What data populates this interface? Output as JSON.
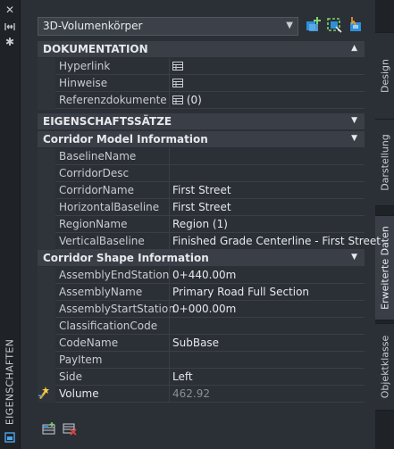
{
  "palette": {
    "title": "EIGENSCHAFTEN",
    "tabs": [
      "Design",
      "Darstellung",
      "Erweiterte Daten",
      "Objektklasse"
    ],
    "active_tab": "Erweiterte Daten"
  },
  "selector": {
    "value": "3D-Volumenkörper"
  },
  "toolbar": {
    "icons": [
      "quick-select-add-icon",
      "select-objects-icon",
      "toggle-pickadd-icon"
    ]
  },
  "sections": {
    "dokumentation": {
      "label": "DOKUMENTATION",
      "rows": [
        {
          "name": "Hyperlink",
          "value": ""
        },
        {
          "name": "Hinweise",
          "value": ""
        },
        {
          "name": "Referenzdokumente",
          "value": "(0)"
        }
      ]
    },
    "eigenschaftssaetze": {
      "label": "EIGENSCHAFTSSÄTZE"
    },
    "corridor_model": {
      "label": "Corridor Model Information",
      "rows": [
        {
          "name": "BaselineName",
          "value": ""
        },
        {
          "name": "CorridorDesc",
          "value": ""
        },
        {
          "name": "CorridorName",
          "value": "First Street"
        },
        {
          "name": "HorizontalBaseline",
          "value": "First Street"
        },
        {
          "name": "RegionName",
          "value": "Region (1)"
        },
        {
          "name": "VerticalBaseline",
          "value": "Finished Grade Centerline - First Street"
        }
      ]
    },
    "corridor_shape": {
      "label": "Corridor Shape Information",
      "rows": [
        {
          "name": "AssemblyEndStation",
          "value": "0+440.00m"
        },
        {
          "name": "AssemblyName",
          "value": "Primary Road Full Section"
        },
        {
          "name": "AssemblyStartStation",
          "value": "0+000.00m"
        },
        {
          "name": "ClassificationCode",
          "value": ""
        },
        {
          "name": "CodeName",
          "value": "SubBase"
        },
        {
          "name": "PayItem",
          "value": ""
        },
        {
          "name": "Side",
          "value": "Left"
        },
        {
          "name": "Volume",
          "value": "462.92"
        }
      ]
    }
  },
  "colors": {
    "background": "#2b2f36",
    "category": "#3a3f47",
    "accent": "#2f8fd8"
  }
}
